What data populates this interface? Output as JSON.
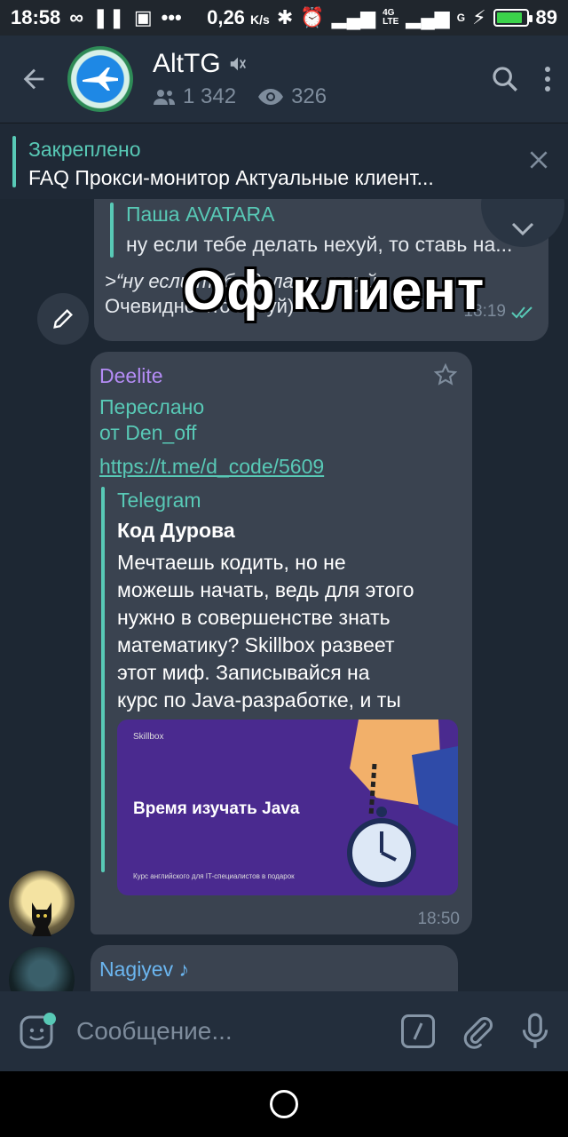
{
  "status": {
    "time": "18:58",
    "speed": "0,26",
    "speed_unit": "K/s",
    "battery": "89",
    "battery_level": 0.89,
    "network_4g": "4G",
    "network_g": "G",
    "network_lte": "LTE"
  },
  "header": {
    "title": "AltTG",
    "members": "1 342",
    "views": "326"
  },
  "pinned": {
    "label": "Закреплено",
    "text": "FAQ  Прокси-монитор  Актуальные клиент..."
  },
  "messages": {
    "reply": {
      "name": "Паша AVATARA",
      "text": "ну если тебе делать нехуй, то ставь на...",
      "quote": ">“ну если тебе делать нехуй",
      "body": "Очевидно что нехуй)",
      "time": "18:19"
    },
    "overlay_caption": "Оф клиент",
    "forwarded": {
      "sender": "Deelite",
      "forward_line1": "Переслано",
      "forward_line2": "от Den_off",
      "link": "https://t.me/d_code/5609",
      "preview_site": "Telegram",
      "preview_title": "Код Дурова",
      "preview_lines": [
        "Мечтаешь кодить, но не",
        "можешь начать, ведь для этого",
        "нужно в совершенстве знать",
        "математику? Skillbox развеет",
        "этот миф. Записывайся на",
        "курс по Java-разработке, и ты"
      ],
      "image_brand": "Skillbox",
      "image_title": "Время изучать Java",
      "image_subtitle": "Курс английского для IT-специалистов в подарок",
      "time": "18:50"
    },
    "next": {
      "sender": "Nagiyev ♪"
    }
  },
  "input": {
    "placeholder": "Сообщение..."
  },
  "icons": {
    "back": "back-arrow-icon",
    "mute": "mute-icon",
    "search": "search-icon",
    "more": "more-vertical-icon",
    "close": "close-icon",
    "emoji": "sticker-icon",
    "attach": "paperclip-icon",
    "mic": "microphone-icon"
  },
  "colors": {
    "accent": "#58c9b6",
    "sender_purple": "#b48cf5",
    "sender_blue": "#6bb6f0",
    "bubble": "#3a4350",
    "background": "#1d2733"
  }
}
